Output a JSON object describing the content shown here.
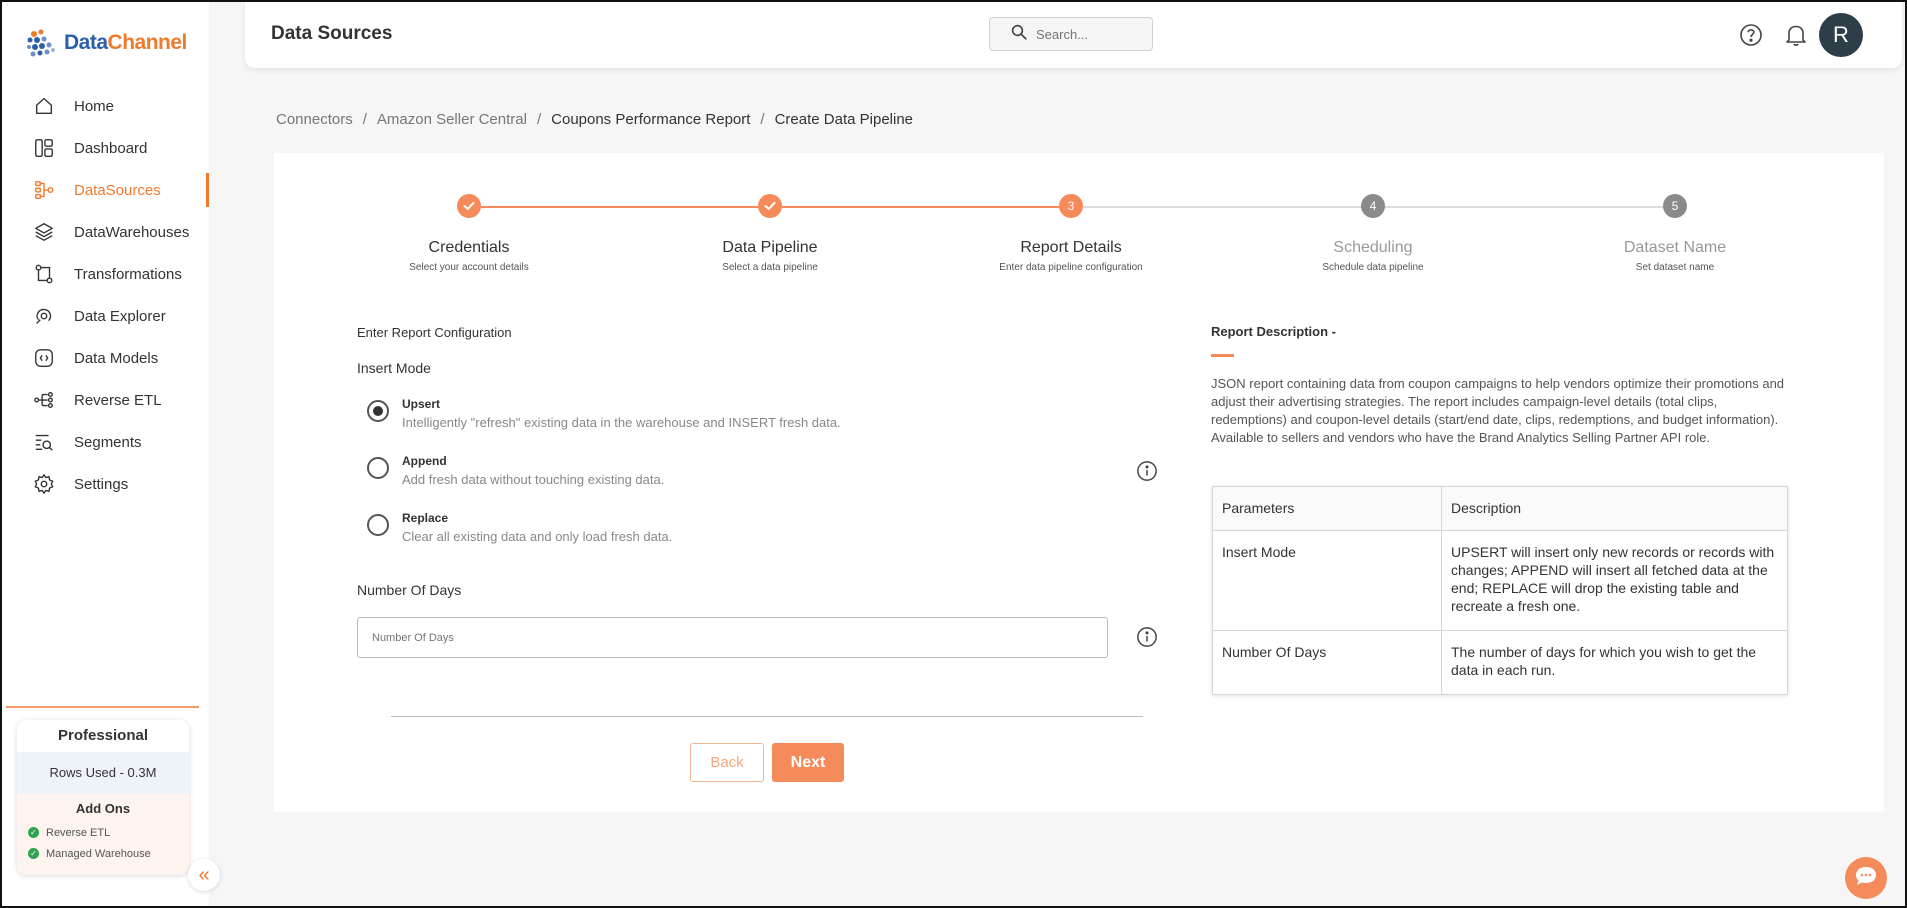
{
  "app": {
    "logo_text_1": "Data",
    "logo_text_2": "Channel",
    "accent_color": "#f07a2b"
  },
  "sidebar": {
    "items": [
      {
        "label": "Home",
        "icon": "home-icon",
        "active": false
      },
      {
        "label": "Dashboard",
        "icon": "dashboard-icon",
        "active": false
      },
      {
        "label": "DataSources",
        "icon": "datasources-icon",
        "active": true
      },
      {
        "label": "DataWarehouses",
        "icon": "layers-icon",
        "active": false
      },
      {
        "label": "Transformations",
        "icon": "transform-icon",
        "active": false
      },
      {
        "label": "Data Explorer",
        "icon": "explorer-icon",
        "active": false
      },
      {
        "label": "Data Models",
        "icon": "models-icon",
        "active": false
      },
      {
        "label": "Reverse ETL",
        "icon": "reverse-etl-icon",
        "active": false
      },
      {
        "label": "Segments",
        "icon": "segments-icon",
        "active": false
      },
      {
        "label": "Settings",
        "icon": "gear-icon",
        "active": false
      }
    ],
    "plan": {
      "name": "Professional",
      "rows_used": "Rows Used - 0.3M",
      "addons_title": "Add Ons",
      "addons": [
        "Reverse ETL",
        "Managed Warehouse"
      ]
    }
  },
  "header": {
    "title": "Data Sources",
    "search_placeholder": "Search...",
    "avatar_initial": "R"
  },
  "breadcrumb": {
    "items": [
      "Connectors",
      "Amazon Seller Central",
      "Coupons Performance Report",
      "Create Data Pipeline"
    ],
    "separator": "/"
  },
  "stepper": {
    "steps": [
      {
        "number": "1",
        "label": "Credentials",
        "sub": "Select your account details",
        "state": "done"
      },
      {
        "number": "2",
        "label": "Data Pipeline",
        "sub": "Select a data pipeline",
        "state": "done"
      },
      {
        "number": "3",
        "label": "Report Details",
        "sub": "Enter data pipeline configuration",
        "state": "current"
      },
      {
        "number": "4",
        "label": "Scheduling",
        "sub": "Schedule data pipeline",
        "state": "pending"
      },
      {
        "number": "5",
        "label": "Dataset Name",
        "sub": "Set dataset name",
        "state": "pending"
      }
    ]
  },
  "form": {
    "section_title": "Enter Report Configuration",
    "insert_mode_title": "Insert Mode",
    "modes": [
      {
        "label": "Upsert",
        "desc": "Intelligently \"refresh\" existing data in the warehouse and INSERT fresh data.",
        "checked": true
      },
      {
        "label": "Append",
        "desc": "Add fresh data without touching existing data.",
        "checked": false
      },
      {
        "label": "Replace",
        "desc": "Clear all existing data and only load fresh data.",
        "checked": false
      }
    ],
    "days_title": "Number Of Days",
    "days_placeholder": "Number Of Days",
    "back_label": "Back",
    "next_label": "Next"
  },
  "description": {
    "title": "Report Description -",
    "text": "JSON report containing data from coupon campaigns to help vendors optimize their promotions and adjust their advertising strategies. The report includes campaign-level details (total clips, redemptions) and coupon-level details (start/end date, clips, redemptions, and budget information). Available to sellers and vendors who have the Brand Analytics Selling Partner API role.",
    "table": {
      "headers": [
        "Parameters",
        "Description"
      ],
      "rows": [
        [
          "Insert Mode",
          "UPSERT will insert only new records or records with changes; APPEND will insert all fetched data at the end; REPLACE will drop the existing table and recreate a fresh one."
        ],
        [
          "Number Of Days",
          "The number of days for which you wish to get the data in each run."
        ]
      ]
    }
  }
}
